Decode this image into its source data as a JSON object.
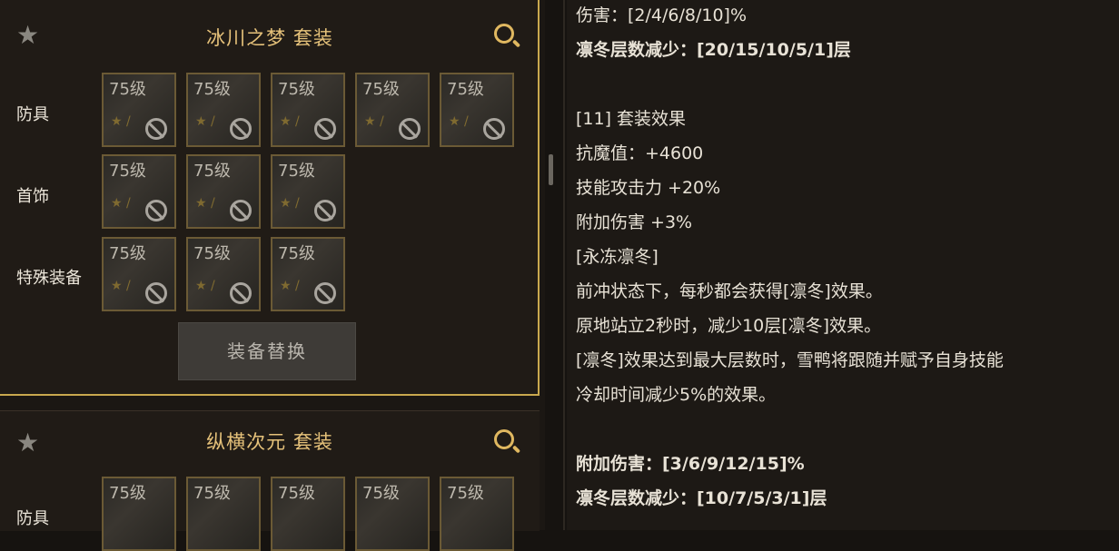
{
  "left_panel": {
    "sets": [
      {
        "title": "冰川之梦  套装",
        "rows": [
          {
            "label": "防具",
            "slots": [
              "75级",
              "75级",
              "75级",
              "75级",
              "75级"
            ]
          },
          {
            "label": "首饰",
            "slots": [
              "75级",
              "75级",
              "75级"
            ]
          },
          {
            "label": "特殊装备",
            "slots": [
              "75级",
              "75级",
              "75级"
            ]
          }
        ],
        "replace_button": "装备替换"
      },
      {
        "title": "纵横次元  套装",
        "rows": [
          {
            "label": "防具",
            "slots": [
              "75级",
              "75级",
              "75级",
              "75级",
              "75级"
            ]
          }
        ]
      }
    ]
  },
  "right_panel": {
    "lines": [
      "伤害：[2/4/6/8/10]%",
      "凛冬层数减少：[20/15/10/5/1]层",
      "",
      "[11] 套装效果",
      "抗魔值：+4600",
      "技能攻击力 +20%",
      "附加伤害 +3%",
      "[永冻凛冬]",
      "前冲状态下，每秒都会获得[凛冬]效果。",
      "原地站立2秒时，减少10层[凛冬]效果。",
      "[凛冬]效果达到最大层数时，雪鸭将跟随并赋予自身技能",
      "冷却时间减少5%的效果。",
      "",
      "附加伤害：[3/6/9/12/15]%",
      "凛冬层数减少：[10/7/5/3/1]层"
    ]
  }
}
